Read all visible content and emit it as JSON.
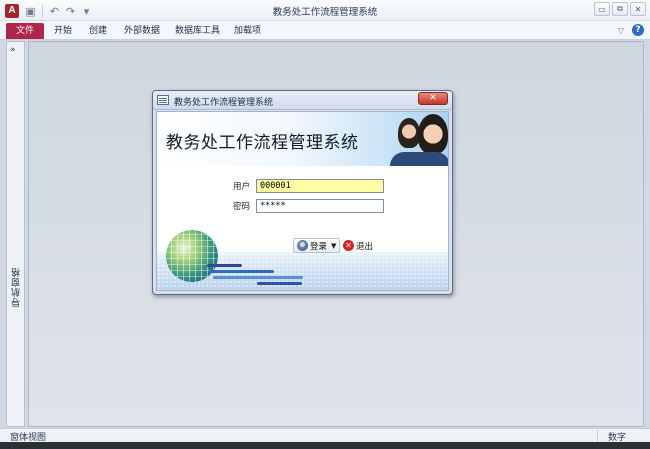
{
  "window": {
    "title": "教务处工作流程管理系统",
    "app_icon_letter": "A",
    "controls": {
      "minimize": "▭",
      "restore": "⧉",
      "close": "✕"
    }
  },
  "qat": {
    "save_icon": "save-icon",
    "undo_icon": "undo-icon",
    "redo_icon": "redo-icon",
    "customize_icon": "customize-icon"
  },
  "ribbon": {
    "tabs": [
      "文件",
      "开始",
      "创建",
      "外部数据",
      "数据库工具",
      "加载项"
    ],
    "help_glyph": "?"
  },
  "nav_pane": {
    "expand_glyph": "»",
    "label": "导航窗格"
  },
  "status_bar": {
    "left": "窗体视图",
    "right": "数字"
  },
  "dialog": {
    "title": "教务处工作流程管理系统",
    "banner_title": "教务处工作流程管理系统",
    "close_glyph": "✕",
    "user_label": "用户",
    "user_value": "000001",
    "password_label": "密码",
    "password_value": "*****",
    "login_label": "登录",
    "exit_label": "退出",
    "exit_glyph": "✕"
  }
}
